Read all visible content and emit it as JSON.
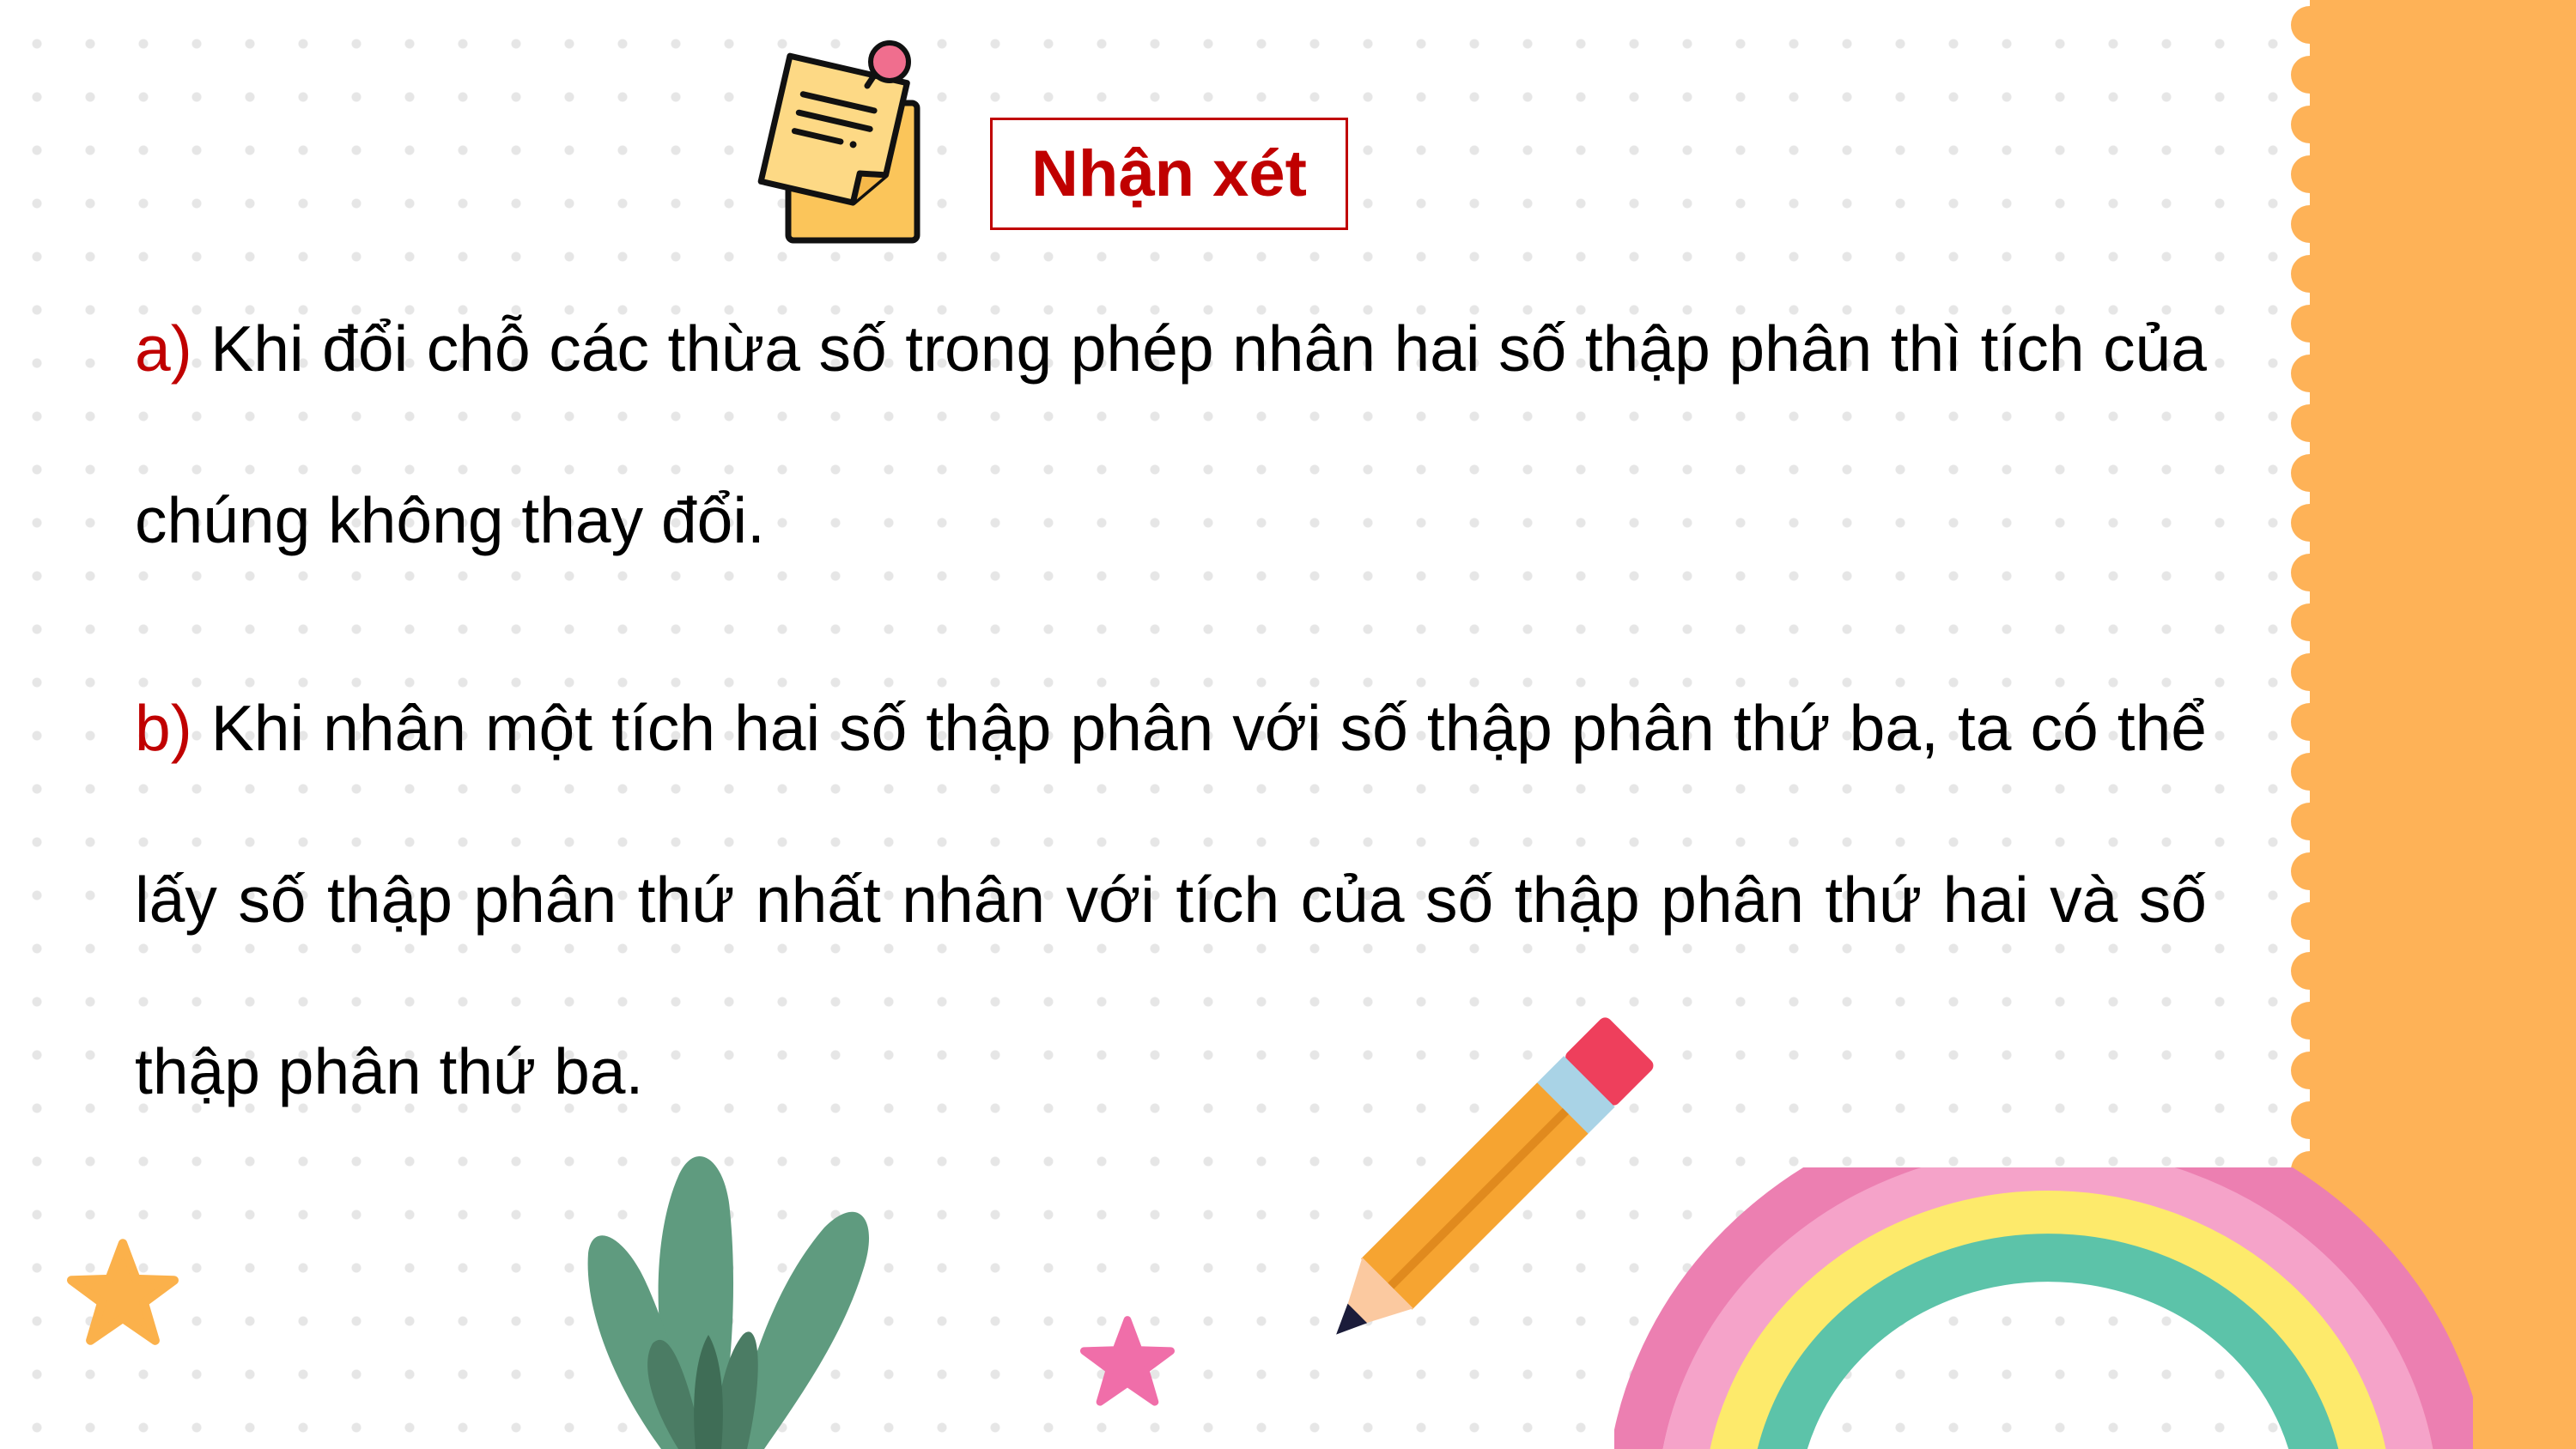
{
  "slide": {
    "title": "Nhận xét",
    "items": [
      {
        "marker": "a)",
        "text": " Khi đổi chỗ các thừa số trong phép nhân hai số thập phân thì tích của chúng không thay đổi."
      },
      {
        "marker": "b)",
        "text": " Khi nhân một tích hai số thập phân với số thập phân thứ ba, ta có thể lấy số thập phân thứ nhất nhân với tích của số thập phân thứ hai và số thập phân thứ ba."
      }
    ]
  },
  "colors": {
    "accent_red": "#c00000",
    "band_orange": "#feb257",
    "rainbow_pink": "#ec7fb1",
    "rainbow_light_pink": "#f5a3c9",
    "rainbow_yellow": "#fdea6b",
    "rainbow_teal": "#5cc3a9",
    "plant_green": "#5f9b7f",
    "pencil_orange": "#f6a431",
    "star_orange": "#fbb14b",
    "star_pink": "#f06ea9",
    "note_yellow": "#fdd985"
  },
  "icons": {
    "note": "sticky-note-icon",
    "pencil": "pencil-icon",
    "plant": "plant-icon",
    "rainbow": "rainbow-icon",
    "star_left": "star-icon",
    "star_center": "star-icon"
  }
}
